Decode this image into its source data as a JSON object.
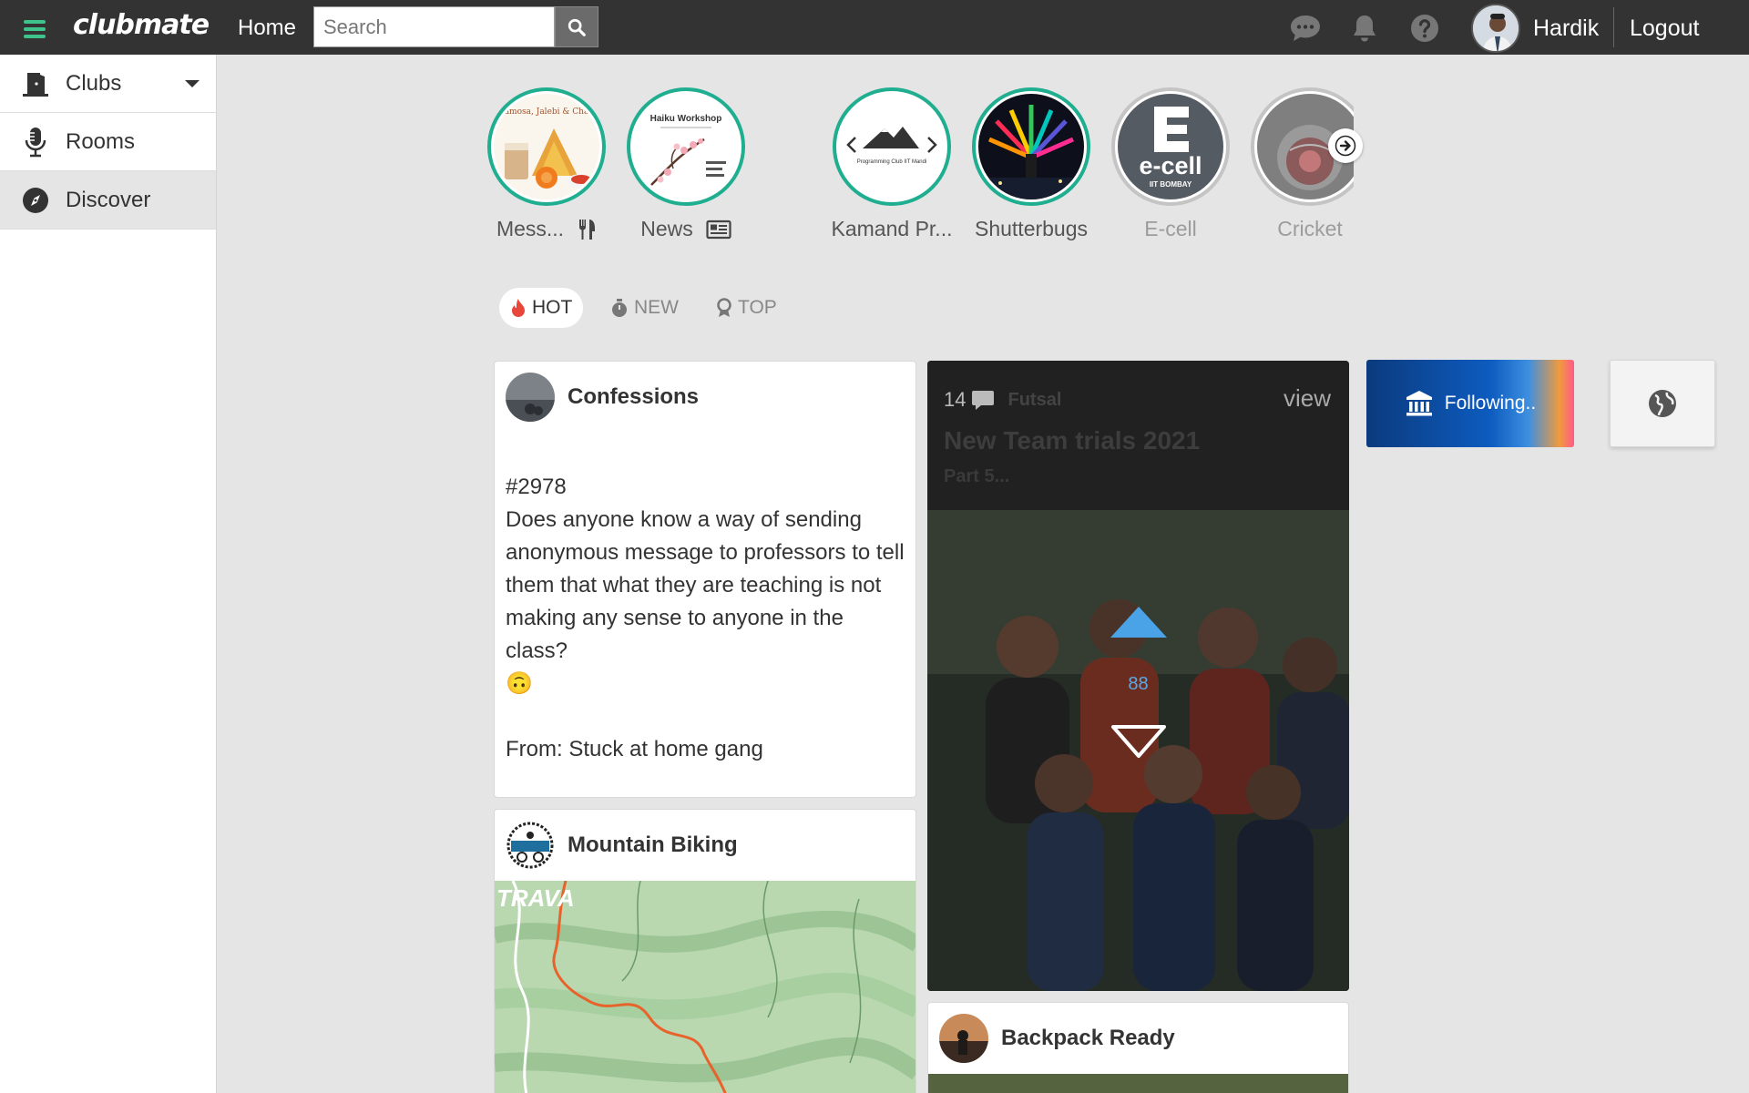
{
  "topbar": {
    "brand": "clubmate",
    "home_label": "Home",
    "search_placeholder": "Search",
    "user_name": "Hardik",
    "logout_label": "Logout",
    "accent_color": "#3ec38a"
  },
  "sidebar": {
    "items": [
      {
        "label": "Clubs",
        "icon": "door-icon"
      },
      {
        "label": "Rooms",
        "icon": "microphone-icon"
      },
      {
        "label": "Discover",
        "icon": "compass-icon"
      }
    ]
  },
  "stories": [
    {
      "label": "Mess...",
      "image_text": "amosa, Jalebi & Cha"
    },
    {
      "label": "News",
      "image_text": "Haiku Workshop"
    },
    {
      "label": "Kamand Pr...",
      "image_text": "Programming Club IIT Mandi"
    },
    {
      "label": "Shutterbugs"
    },
    {
      "label": "E-cell",
      "image_text": "e-cell",
      "image_subtext": "IIT BOMBAY"
    },
    {
      "label": "Cricket"
    }
  ],
  "sort_tabs": {
    "hot": "HOT",
    "new": "NEW",
    "top": "TOP"
  },
  "posts": {
    "confessions": {
      "title": "Confessions",
      "number": "#2978",
      "body": "Does anyone know a way of sending anonymous message to professors to tell them that what they are teaching is not making any sense to anyone in the class?",
      "emoji": "🙃",
      "from": "From: Stuck at home gang"
    },
    "featured": {
      "comment_count": "14",
      "view_label": "view",
      "club": "Futsal",
      "title": "New Team trials 2021",
      "subtitle": "Part 5...",
      "votes": "88"
    },
    "mountain_biking": {
      "title": "Mountain Biking",
      "map_brand": "TRAVA"
    },
    "backpack": {
      "title": "Backpack Ready"
    }
  },
  "widgets": {
    "following_label": "Following.."
  }
}
